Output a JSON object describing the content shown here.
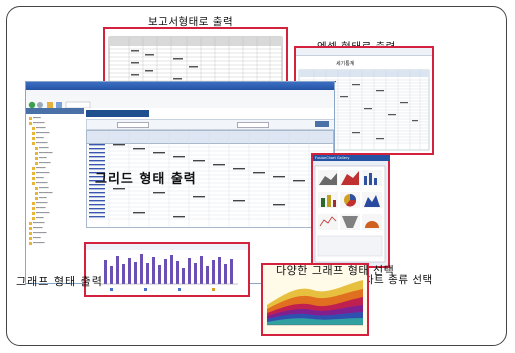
{
  "labels": {
    "report": "보고서형태로 출력",
    "excel": "엑셀 형태로 출력",
    "grid": "그리드 형태 출력",
    "graph": "그래프 형태 출력",
    "chart_type": "차트 종류 선택",
    "graph_variety": "다양한 그래프 형태 선택",
    "excel_sheet_title": "세기통계",
    "gallery_title": "FusionChart Gallery"
  },
  "colors": {
    "highlight_border": "#d4213d",
    "app_title": "#2553a4",
    "bar": "#6a4fb4"
  }
}
